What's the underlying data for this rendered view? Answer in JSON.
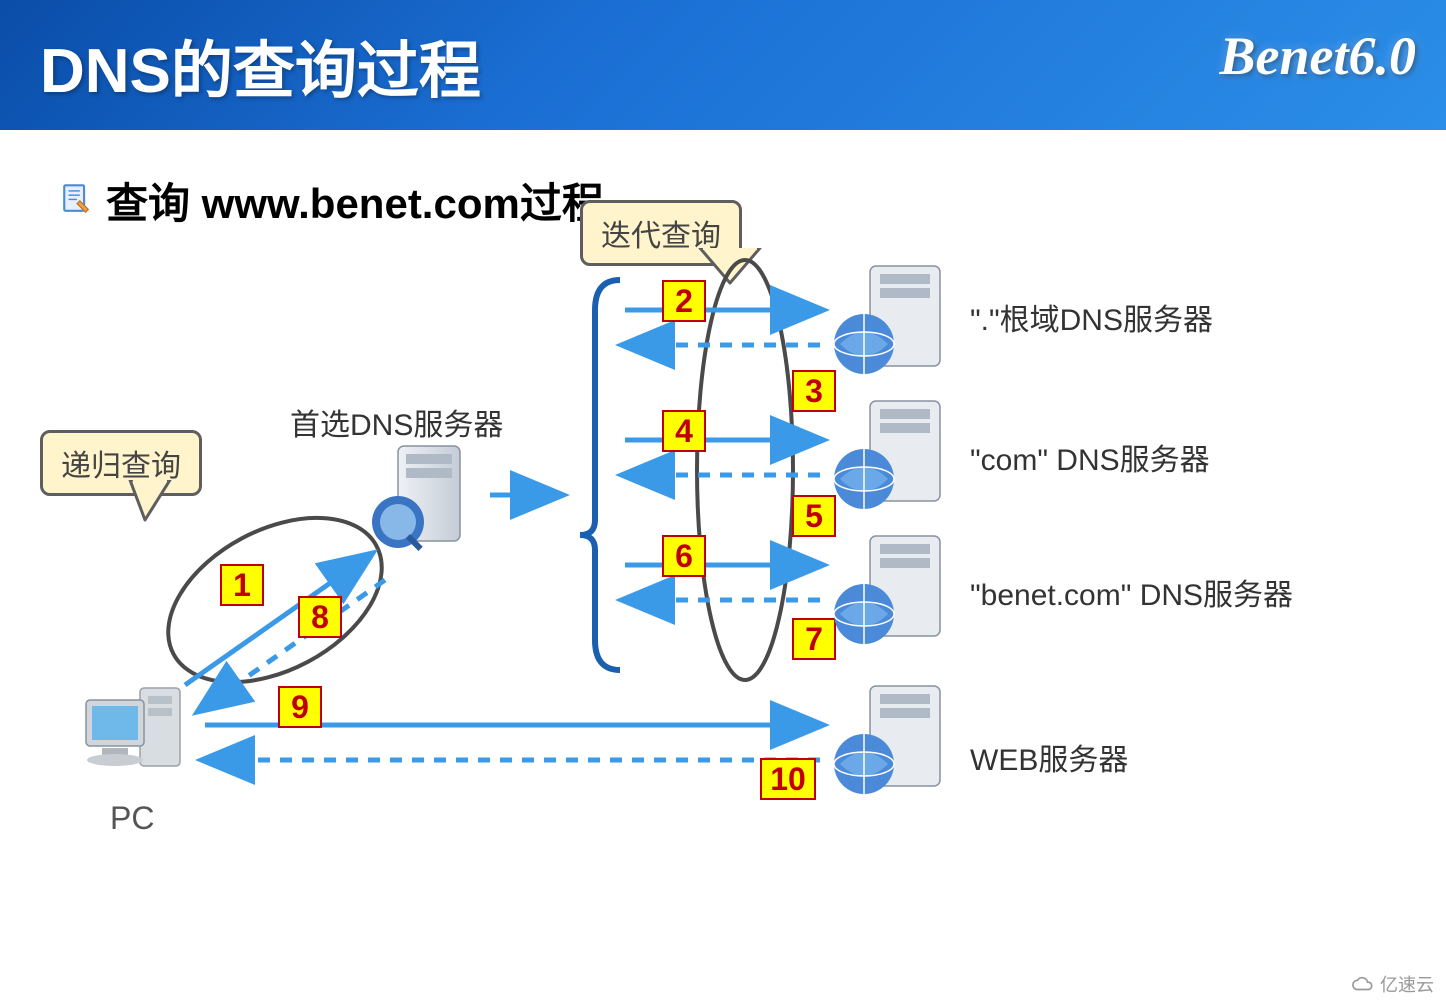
{
  "header": {
    "title": "DNS的查询过程",
    "logo": "Benet6.0"
  },
  "subtitle": "查询 www.benet.com过程",
  "callouts": {
    "recursive": "递归查询",
    "iterative": "迭代查询"
  },
  "nodes": {
    "pc": "PC",
    "preferred_dns": "首选DNS服务器",
    "root_dns": "\".\"根域DNS服务器",
    "com_dns": "\"com\" DNS服务器",
    "benet_dns": "\"benet.com\" DNS服务器",
    "web_server": "WEB服务器"
  },
  "steps": {
    "s1": "1",
    "s2": "2",
    "s3": "3",
    "s4": "4",
    "s5": "5",
    "s6": "6",
    "s7": "7",
    "s8": "8",
    "s9": "9",
    "s10": "10"
  },
  "watermark": "亿速云"
}
